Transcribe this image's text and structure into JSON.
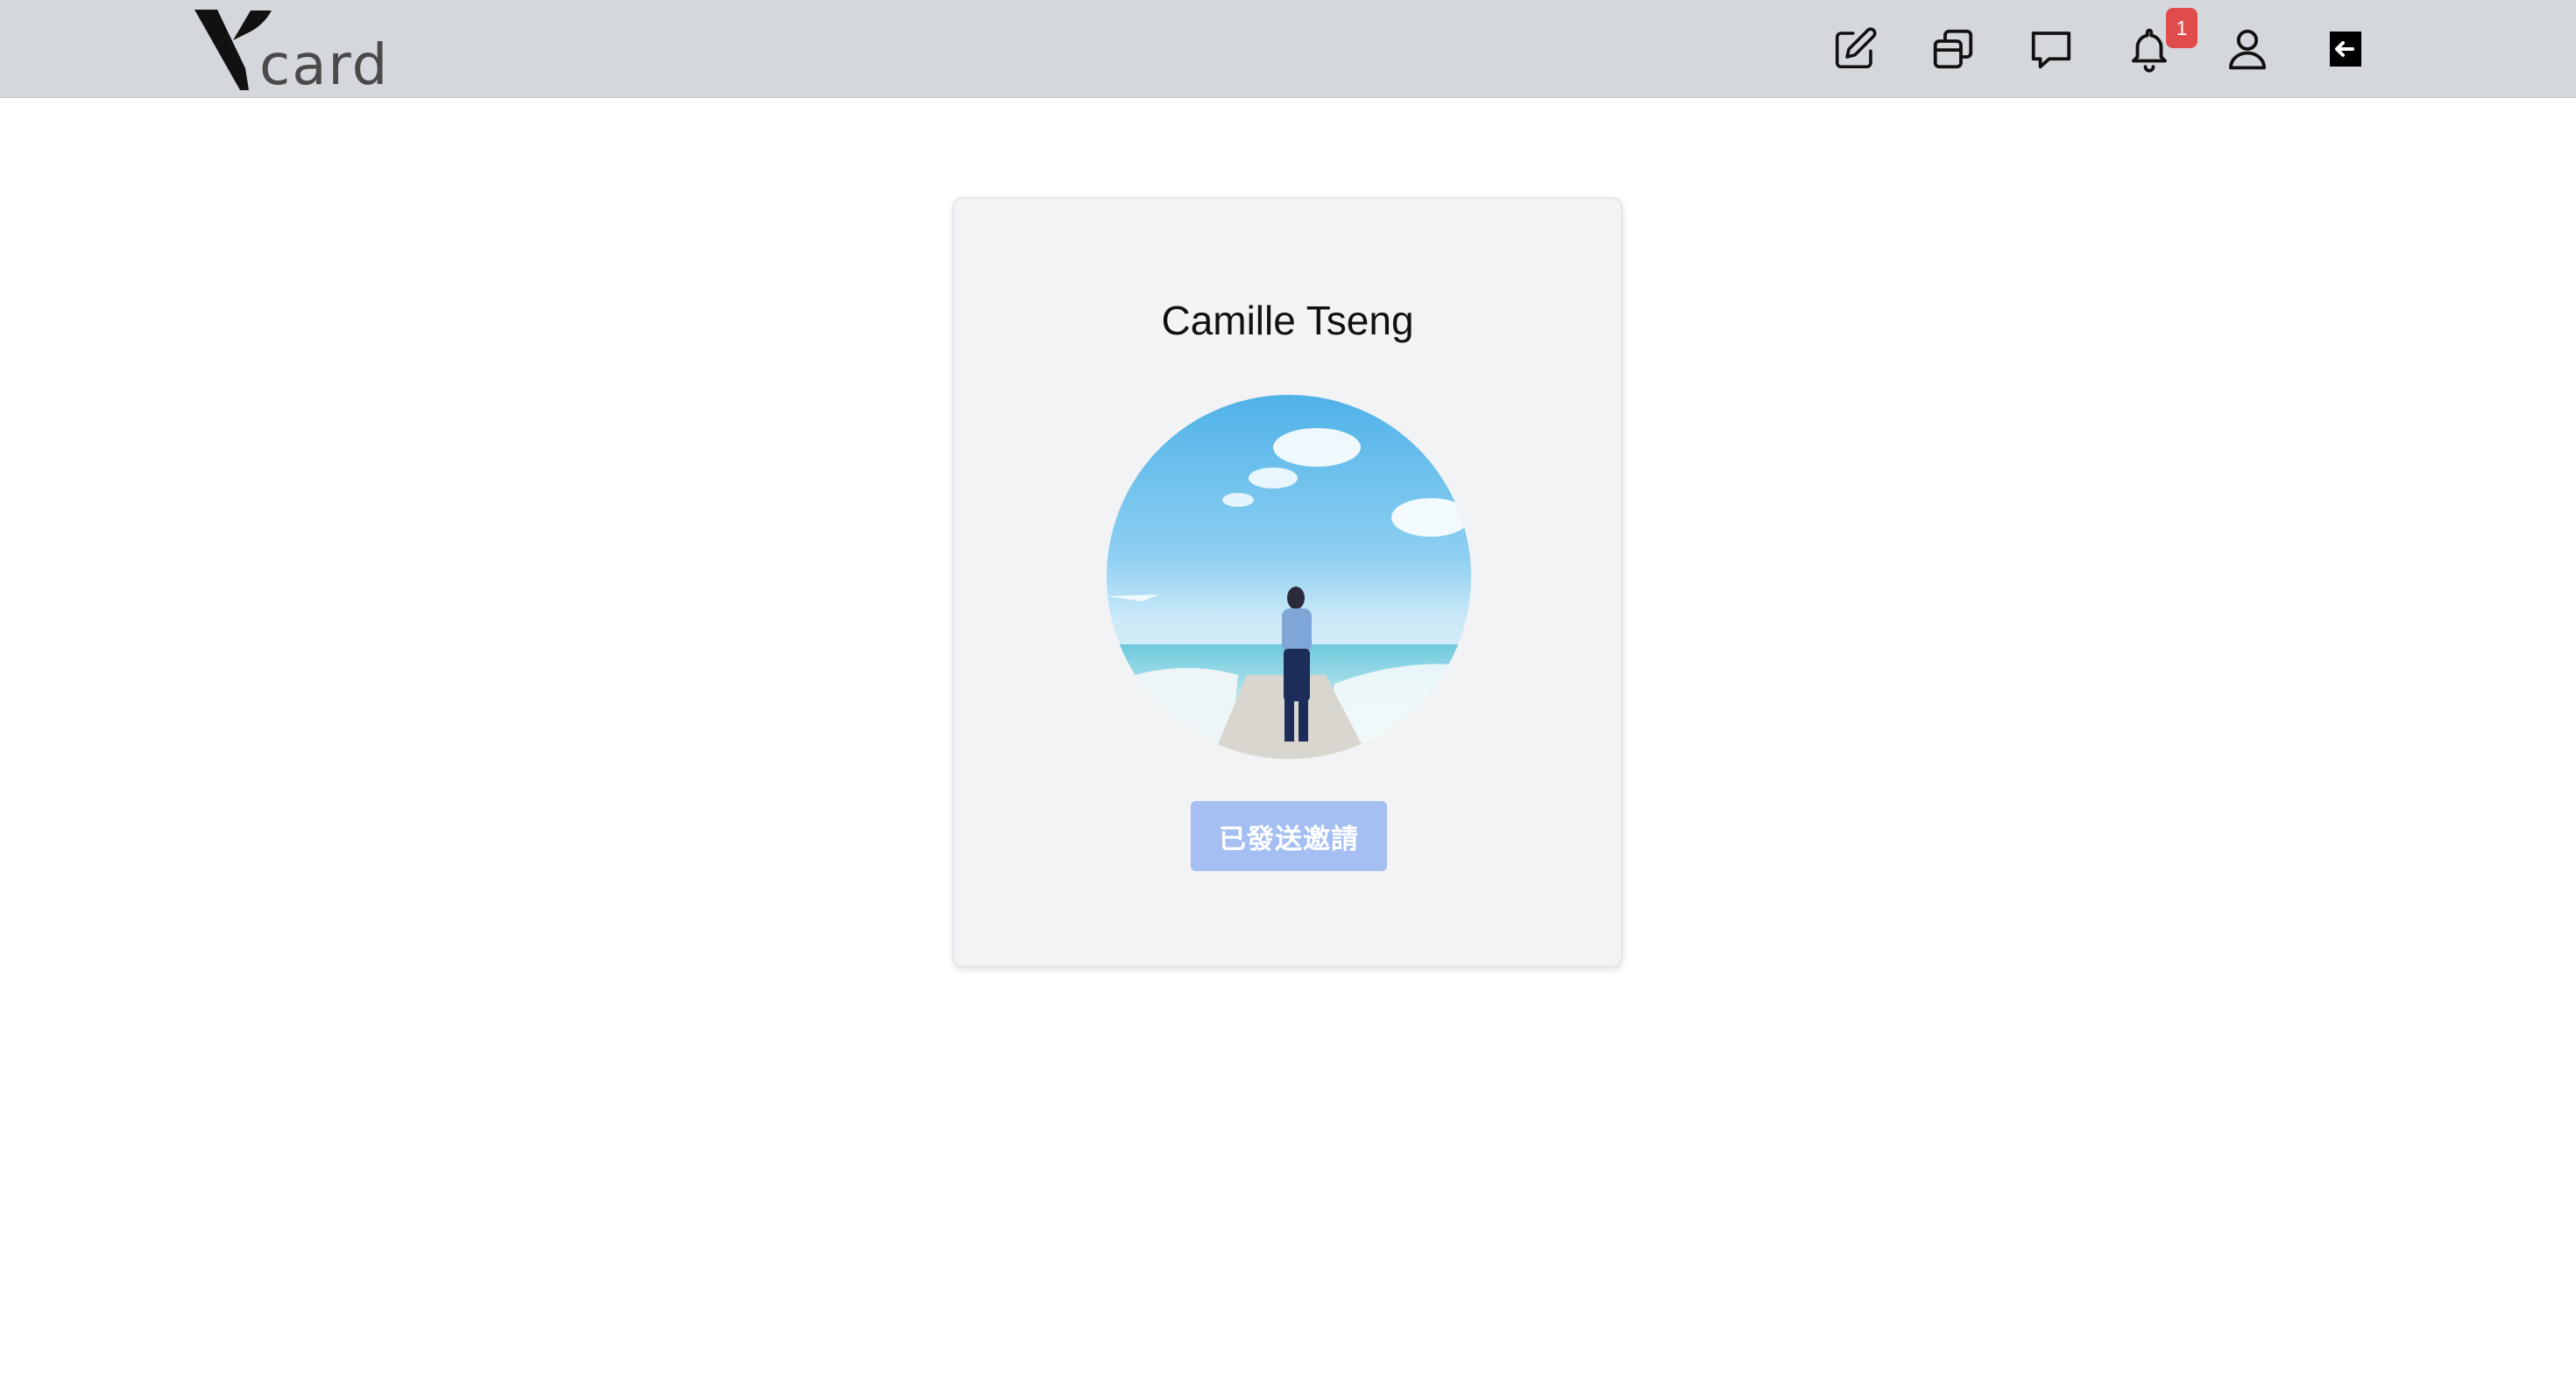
{
  "brand": {
    "logo_text": "card",
    "logo_alt": "Vcard"
  },
  "navbar": {
    "icons": [
      {
        "name": "edit-icon"
      },
      {
        "name": "cards-icon"
      },
      {
        "name": "chat-icon"
      },
      {
        "name": "bell-icon"
      },
      {
        "name": "user-icon"
      },
      {
        "name": "logout-icon"
      }
    ],
    "notification_count": "1"
  },
  "profile": {
    "name": "Camille Tseng",
    "invite_button_label": "已發送邀請",
    "invite_state": "disabled"
  },
  "colors": {
    "navbar_bg": "#d4d7db",
    "card_bg": "#f2f3f5",
    "badge": "#e04b4b",
    "button_disabled": "#a5bff2"
  }
}
